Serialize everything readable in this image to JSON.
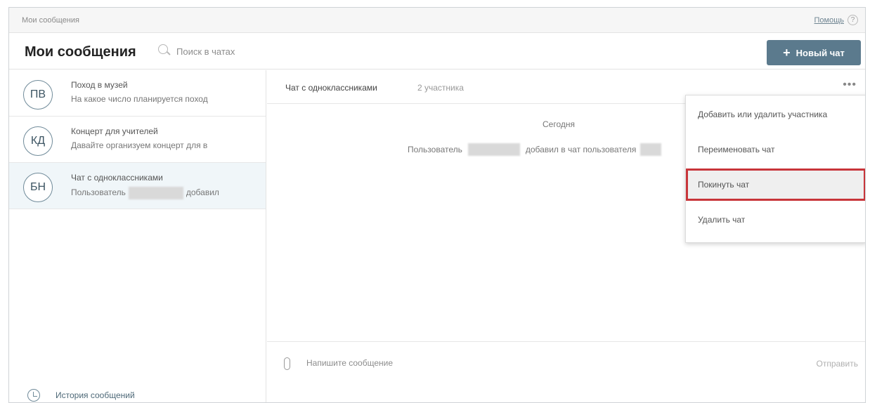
{
  "topbar": {
    "breadcrumb": "Мои сообщения",
    "help_link": "Помощь",
    "help_icon_glyph": "?"
  },
  "header": {
    "title": "Мои сообщения",
    "search_placeholder": "Поиск в чатах",
    "new_chat_icon": "+",
    "new_chat_label": "Новый чат"
  },
  "chats": [
    {
      "initials": "ПВ",
      "name": "Поход в музей",
      "preview": "На какое число планируется поход"
    },
    {
      "initials": "КД",
      "name": "Концерт для учителей",
      "preview": "Давайте организуем концерт для в"
    },
    {
      "initials": "БН",
      "name": "Чат с одноклассниками",
      "preview_start": "Пользователь",
      "preview_end": "добавил"
    }
  ],
  "history_label": "История сообщений",
  "chat": {
    "name": "Чат с одноклассниками",
    "members": "2 участника",
    "more_icon": "•••",
    "date_label": "Сегодня",
    "system_message_start": "Пользователь",
    "system_message_mid": "добавил в чат пользователя"
  },
  "composer": {
    "placeholder": "Напишите сообщение",
    "send_label": "Отправить"
  },
  "menu": {
    "items": [
      "Добавить или удалить участника",
      "Переименовать чат",
      "Покинуть чат",
      "Удалить чат"
    ]
  },
  "colors": {
    "accent": "#5b7a8d",
    "highlight_border": "#c8353a",
    "active_row": "#f0f6f9"
  }
}
